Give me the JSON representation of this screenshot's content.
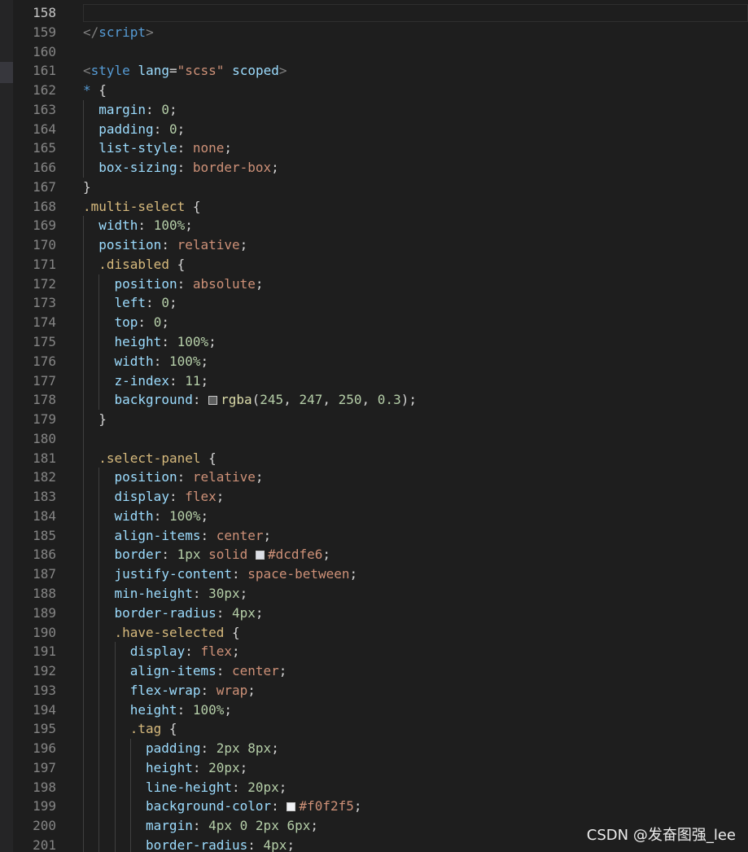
{
  "editor": {
    "watermark": "CSDN @发奋图强_lee",
    "current_line": "158",
    "colors": {
      "background": "#1e1e1e",
      "line_number": "#858585",
      "tag": "#569cd6",
      "selector": "#d7ba7d",
      "property": "#9cdcfe",
      "string_value": "#ce9178",
      "number": "#b5cea8"
    },
    "lines": [
      {
        "n": "158",
        "indent": 0,
        "tokens": []
      },
      {
        "n": "159",
        "indent": 0,
        "tokens": [
          {
            "t": "</",
            "c": "punc"
          },
          {
            "t": "script",
            "c": "tag"
          },
          {
            "t": ">",
            "c": "punc"
          }
        ]
      },
      {
        "n": "160",
        "indent": 0,
        "tokens": []
      },
      {
        "n": "161",
        "indent": 0,
        "tokens": [
          {
            "t": "<",
            "c": "punc"
          },
          {
            "t": "style",
            "c": "tag"
          },
          {
            "t": " ",
            "c": "txt"
          },
          {
            "t": "lang",
            "c": "attr"
          },
          {
            "t": "=",
            "c": "txt"
          },
          {
            "t": "\"scss\"",
            "c": "str"
          },
          {
            "t": " ",
            "c": "txt"
          },
          {
            "t": "scoped",
            "c": "attr"
          },
          {
            "t": ">",
            "c": "punc"
          }
        ]
      },
      {
        "n": "162",
        "indent": 0,
        "tokens": [
          {
            "t": "*",
            "c": "tag"
          },
          {
            "t": " {",
            "c": "txt"
          }
        ]
      },
      {
        "n": "163",
        "indent": 1,
        "tokens": [
          {
            "t": "margin",
            "c": "prop"
          },
          {
            "t": ": ",
            "c": "txt"
          },
          {
            "t": "0",
            "c": "num"
          },
          {
            "t": ";",
            "c": "txt"
          }
        ]
      },
      {
        "n": "164",
        "indent": 1,
        "tokens": [
          {
            "t": "padding",
            "c": "prop"
          },
          {
            "t": ": ",
            "c": "txt"
          },
          {
            "t": "0",
            "c": "num"
          },
          {
            "t": ";",
            "c": "txt"
          }
        ]
      },
      {
        "n": "165",
        "indent": 1,
        "tokens": [
          {
            "t": "list-style",
            "c": "prop"
          },
          {
            "t": ": ",
            "c": "txt"
          },
          {
            "t": "none",
            "c": "val"
          },
          {
            "t": ";",
            "c": "txt"
          }
        ]
      },
      {
        "n": "166",
        "indent": 1,
        "tokens": [
          {
            "t": "box-sizing",
            "c": "prop"
          },
          {
            "t": ": ",
            "c": "txt"
          },
          {
            "t": "border-box",
            "c": "val"
          },
          {
            "t": ";",
            "c": "txt"
          }
        ]
      },
      {
        "n": "167",
        "indent": 0,
        "tokens": [
          {
            "t": "}",
            "c": "txt"
          }
        ]
      },
      {
        "n": "168",
        "indent": 0,
        "tokens": [
          {
            "t": ".multi-select",
            "c": "sel"
          },
          {
            "t": " {",
            "c": "txt"
          }
        ]
      },
      {
        "n": "169",
        "indent": 1,
        "tokens": [
          {
            "t": "width",
            "c": "prop"
          },
          {
            "t": ": ",
            "c": "txt"
          },
          {
            "t": "100%",
            "c": "num"
          },
          {
            "t": ";",
            "c": "txt"
          }
        ]
      },
      {
        "n": "170",
        "indent": 1,
        "tokens": [
          {
            "t": "position",
            "c": "prop"
          },
          {
            "t": ": ",
            "c": "txt"
          },
          {
            "t": "relative",
            "c": "val"
          },
          {
            "t": ";",
            "c": "txt"
          }
        ]
      },
      {
        "n": "171",
        "indent": 1,
        "tokens": [
          {
            "t": ".disabled",
            "c": "sel"
          },
          {
            "t": " {",
            "c": "txt"
          }
        ]
      },
      {
        "n": "172",
        "indent": 2,
        "tokens": [
          {
            "t": "position",
            "c": "prop"
          },
          {
            "t": ": ",
            "c": "txt"
          },
          {
            "t": "absolute",
            "c": "val"
          },
          {
            "t": ";",
            "c": "txt"
          }
        ]
      },
      {
        "n": "173",
        "indent": 2,
        "tokens": [
          {
            "t": "left",
            "c": "prop"
          },
          {
            "t": ": ",
            "c": "txt"
          },
          {
            "t": "0",
            "c": "num"
          },
          {
            "t": ";",
            "c": "txt"
          }
        ]
      },
      {
        "n": "174",
        "indent": 2,
        "tokens": [
          {
            "t": "top",
            "c": "prop"
          },
          {
            "t": ": ",
            "c": "txt"
          },
          {
            "t": "0",
            "c": "num"
          },
          {
            "t": ";",
            "c": "txt"
          }
        ]
      },
      {
        "n": "175",
        "indent": 2,
        "tokens": [
          {
            "t": "height",
            "c": "prop"
          },
          {
            "t": ": ",
            "c": "txt"
          },
          {
            "t": "100%",
            "c": "num"
          },
          {
            "t": ";",
            "c": "txt"
          }
        ]
      },
      {
        "n": "176",
        "indent": 2,
        "tokens": [
          {
            "t": "width",
            "c": "prop"
          },
          {
            "t": ": ",
            "c": "txt"
          },
          {
            "t": "100%",
            "c": "num"
          },
          {
            "t": ";",
            "c": "txt"
          }
        ]
      },
      {
        "n": "177",
        "indent": 2,
        "tokens": [
          {
            "t": "z-index",
            "c": "prop"
          },
          {
            "t": ": ",
            "c": "txt"
          },
          {
            "t": "11",
            "c": "num"
          },
          {
            "t": ";",
            "c": "txt"
          }
        ]
      },
      {
        "n": "178",
        "indent": 2,
        "tokens": [
          {
            "t": "background",
            "c": "prop"
          },
          {
            "t": ": ",
            "c": "txt"
          },
          {
            "swatch": "rgba(245, 247, 250, 0.3)"
          },
          {
            "t": "rgba",
            "c": "fn"
          },
          {
            "t": "(",
            "c": "txt"
          },
          {
            "t": "245",
            "c": "num"
          },
          {
            "t": ", ",
            "c": "txt"
          },
          {
            "t": "247",
            "c": "num"
          },
          {
            "t": ", ",
            "c": "txt"
          },
          {
            "t": "250",
            "c": "num"
          },
          {
            "t": ", ",
            "c": "txt"
          },
          {
            "t": "0.3",
            "c": "num"
          },
          {
            "t": ");",
            "c": "txt"
          }
        ]
      },
      {
        "n": "179",
        "indent": 1,
        "tokens": [
          {
            "t": "}",
            "c": "txt"
          }
        ]
      },
      {
        "n": "180",
        "indent": 1,
        "tokens": []
      },
      {
        "n": "181",
        "indent": 1,
        "tokens": [
          {
            "t": ".select-panel",
            "c": "sel"
          },
          {
            "t": " {",
            "c": "txt"
          }
        ]
      },
      {
        "n": "182",
        "indent": 2,
        "tokens": [
          {
            "t": "position",
            "c": "prop"
          },
          {
            "t": ": ",
            "c": "txt"
          },
          {
            "t": "relative",
            "c": "val"
          },
          {
            "t": ";",
            "c": "txt"
          }
        ]
      },
      {
        "n": "183",
        "indent": 2,
        "tokens": [
          {
            "t": "display",
            "c": "prop"
          },
          {
            "t": ": ",
            "c": "txt"
          },
          {
            "t": "flex",
            "c": "val"
          },
          {
            "t": ";",
            "c": "txt"
          }
        ]
      },
      {
        "n": "184",
        "indent": 2,
        "tokens": [
          {
            "t": "width",
            "c": "prop"
          },
          {
            "t": ": ",
            "c": "txt"
          },
          {
            "t": "100%",
            "c": "num"
          },
          {
            "t": ";",
            "c": "txt"
          }
        ]
      },
      {
        "n": "185",
        "indent": 2,
        "tokens": [
          {
            "t": "align-items",
            "c": "prop"
          },
          {
            "t": ": ",
            "c": "txt"
          },
          {
            "t": "center",
            "c": "val"
          },
          {
            "t": ";",
            "c": "txt"
          }
        ]
      },
      {
        "n": "186",
        "indent": 2,
        "tokens": [
          {
            "t": "border",
            "c": "prop"
          },
          {
            "t": ": ",
            "c": "txt"
          },
          {
            "t": "1px",
            "c": "num"
          },
          {
            "t": " ",
            "c": "txt"
          },
          {
            "t": "solid",
            "c": "val"
          },
          {
            "t": " ",
            "c": "txt"
          },
          {
            "swatch": "#dcdfe6"
          },
          {
            "t": "#dcdfe6",
            "c": "val"
          },
          {
            "t": ";",
            "c": "txt"
          }
        ]
      },
      {
        "n": "187",
        "indent": 2,
        "tokens": [
          {
            "t": "justify-content",
            "c": "prop"
          },
          {
            "t": ": ",
            "c": "txt"
          },
          {
            "t": "space-between",
            "c": "val"
          },
          {
            "t": ";",
            "c": "txt"
          }
        ]
      },
      {
        "n": "188",
        "indent": 2,
        "tokens": [
          {
            "t": "min-height",
            "c": "prop"
          },
          {
            "t": ": ",
            "c": "txt"
          },
          {
            "t": "30px",
            "c": "num"
          },
          {
            "t": ";",
            "c": "txt"
          }
        ]
      },
      {
        "n": "189",
        "indent": 2,
        "tokens": [
          {
            "t": "border-radius",
            "c": "prop"
          },
          {
            "t": ": ",
            "c": "txt"
          },
          {
            "t": "4px",
            "c": "num"
          },
          {
            "t": ";",
            "c": "txt"
          }
        ]
      },
      {
        "n": "190",
        "indent": 2,
        "tokens": [
          {
            "t": ".have-selected",
            "c": "sel"
          },
          {
            "t": " {",
            "c": "txt"
          }
        ]
      },
      {
        "n": "191",
        "indent": 3,
        "tokens": [
          {
            "t": "display",
            "c": "prop"
          },
          {
            "t": ": ",
            "c": "txt"
          },
          {
            "t": "flex",
            "c": "val"
          },
          {
            "t": ";",
            "c": "txt"
          }
        ]
      },
      {
        "n": "192",
        "indent": 3,
        "tokens": [
          {
            "t": "align-items",
            "c": "prop"
          },
          {
            "t": ": ",
            "c": "txt"
          },
          {
            "t": "center",
            "c": "val"
          },
          {
            "t": ";",
            "c": "txt"
          }
        ]
      },
      {
        "n": "193",
        "indent": 3,
        "tokens": [
          {
            "t": "flex-wrap",
            "c": "prop"
          },
          {
            "t": ": ",
            "c": "txt"
          },
          {
            "t": "wrap",
            "c": "val"
          },
          {
            "t": ";",
            "c": "txt"
          }
        ]
      },
      {
        "n": "194",
        "indent": 3,
        "tokens": [
          {
            "t": "height",
            "c": "prop"
          },
          {
            "t": ": ",
            "c": "txt"
          },
          {
            "t": "100%",
            "c": "num"
          },
          {
            "t": ";",
            "c": "txt"
          }
        ]
      },
      {
        "n": "195",
        "indent": 3,
        "tokens": [
          {
            "t": ".tag",
            "c": "sel"
          },
          {
            "t": " {",
            "c": "txt"
          }
        ]
      },
      {
        "n": "196",
        "indent": 4,
        "tokens": [
          {
            "t": "padding",
            "c": "prop"
          },
          {
            "t": ": ",
            "c": "txt"
          },
          {
            "t": "2px",
            "c": "num"
          },
          {
            "t": " ",
            "c": "txt"
          },
          {
            "t": "8px",
            "c": "num"
          },
          {
            "t": ";",
            "c": "txt"
          }
        ]
      },
      {
        "n": "197",
        "indent": 4,
        "tokens": [
          {
            "t": "height",
            "c": "prop"
          },
          {
            "t": ": ",
            "c": "txt"
          },
          {
            "t": "20px",
            "c": "num"
          },
          {
            "t": ";",
            "c": "txt"
          }
        ]
      },
      {
        "n": "198",
        "indent": 4,
        "tokens": [
          {
            "t": "line-height",
            "c": "prop"
          },
          {
            "t": ": ",
            "c": "txt"
          },
          {
            "t": "20px",
            "c": "num"
          },
          {
            "t": ";",
            "c": "txt"
          }
        ]
      },
      {
        "n": "199",
        "indent": 4,
        "tokens": [
          {
            "t": "background-color",
            "c": "prop"
          },
          {
            "t": ": ",
            "c": "txt"
          },
          {
            "swatch": "#f0f2f5"
          },
          {
            "t": "#f0f2f5",
            "c": "val"
          },
          {
            "t": ";",
            "c": "txt"
          }
        ]
      },
      {
        "n": "200",
        "indent": 4,
        "tokens": [
          {
            "t": "margin",
            "c": "prop"
          },
          {
            "t": ": ",
            "c": "txt"
          },
          {
            "t": "4px",
            "c": "num"
          },
          {
            "t": " ",
            "c": "txt"
          },
          {
            "t": "0",
            "c": "num"
          },
          {
            "t": " ",
            "c": "txt"
          },
          {
            "t": "2px",
            "c": "num"
          },
          {
            "t": " ",
            "c": "txt"
          },
          {
            "t": "6px",
            "c": "num"
          },
          {
            "t": ";",
            "c": "txt"
          }
        ]
      },
      {
        "n": "201",
        "indent": 4,
        "tokens": [
          {
            "t": "border-radius",
            "c": "prop"
          },
          {
            "t": ": ",
            "c": "txt"
          },
          {
            "t": "4px",
            "c": "num"
          },
          {
            "t": ";",
            "c": "txt"
          }
        ]
      }
    ]
  }
}
